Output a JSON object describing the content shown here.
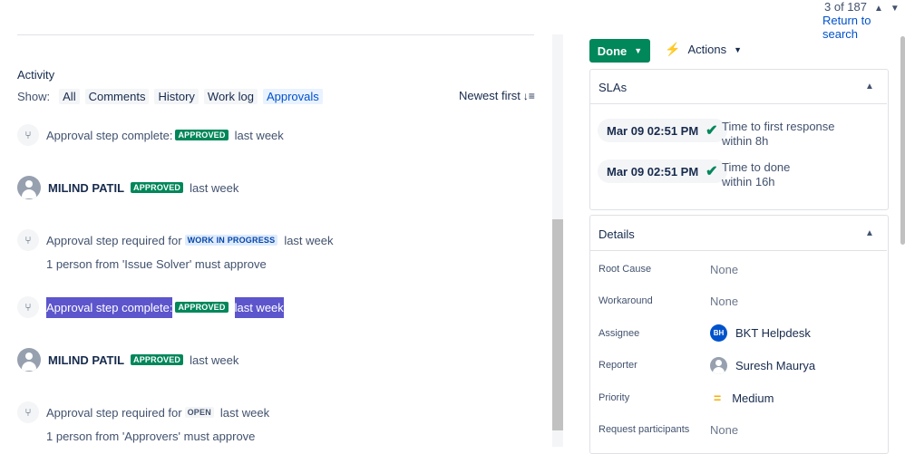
{
  "pager": {
    "position": "3 of 187",
    "up_icon": "chevron-up-icon",
    "down_icon": "chevron-down-icon",
    "return_label": "Return to search"
  },
  "activity": {
    "title": "Activity",
    "show_label": "Show:",
    "filters": [
      "All",
      "Comments",
      "History",
      "Work log",
      "Approvals"
    ],
    "active_filter": "Approvals",
    "sort_label": "Newest first"
  },
  "feed": [
    {
      "type": "approval",
      "text": "Approval step complete:",
      "status": "APPROVED",
      "time": "last week"
    },
    {
      "type": "user",
      "name": "MILIND PATIL",
      "status": "APPROVED",
      "time": "last week"
    },
    {
      "type": "approval",
      "text": "Approval step required for",
      "status": "WORK IN PROGRESS",
      "time": "last week",
      "detail": "1 person from 'Issue Solver' must approve"
    },
    {
      "type": "approval",
      "text": "Approval step complete:",
      "status": "APPROVED",
      "time": "last week",
      "highlighted": true
    },
    {
      "type": "user",
      "name": "MILIND PATIL",
      "status": "APPROVED",
      "time": "last week"
    },
    {
      "type": "approval",
      "text": "Approval step required for",
      "status": "OPEN",
      "time": "last week",
      "detail": "1 person from 'Approvers' must approve"
    }
  ],
  "toolbar": {
    "status_label": "Done",
    "actions_label": "Actions"
  },
  "slas": {
    "title": "SLAs",
    "items": [
      {
        "time": "Mar 09 02:51 PM",
        "name": "Time to first response",
        "target": "within 8h"
      },
      {
        "time": "Mar 09 02:51 PM",
        "name": "Time to done",
        "target": "within 16h"
      }
    ]
  },
  "details": {
    "title": "Details",
    "fields": [
      {
        "label": "Root Cause",
        "value": "None"
      },
      {
        "label": "Workaround",
        "value": "None"
      },
      {
        "label": "Assignee",
        "value": "BKT Helpdesk",
        "initials": "BH"
      },
      {
        "label": "Reporter",
        "value": "Suresh Maurya"
      },
      {
        "label": "Priority",
        "value": "Medium"
      },
      {
        "label": "Request participants",
        "value": "None"
      }
    ]
  },
  "colors": {
    "done": "#00875a",
    "approved": "#00875a",
    "highlight": "#5c55cc",
    "link": "#0052cc"
  }
}
